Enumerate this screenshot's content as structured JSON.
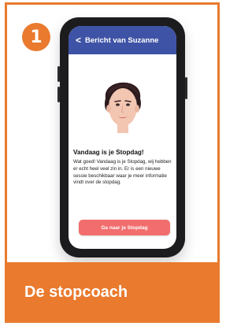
{
  "step": {
    "number": "1"
  },
  "phone": {
    "header": {
      "back_symbol": "<",
      "title": "Bericht van Suzanne"
    },
    "message": {
      "title": "Vandaag is je Stopdag!",
      "body": "Wat goed! Vandaag is je Stopdag, wij hebben er echt heel veel zin in. Er is een nieuwe sessie beschikbaar waar je meer informatie vindt over de stopdag."
    },
    "cta_label": "Ga naar je Stopdag"
  },
  "banner": {
    "title": "De stopcoach"
  },
  "colors": {
    "accent_orange": "#ea7a2e",
    "header_blue": "#3f53a6",
    "button_coral": "#f26d6d"
  }
}
